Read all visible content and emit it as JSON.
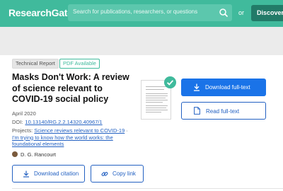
{
  "header": {
    "logo": "ResearchGate",
    "search_placeholder": "Search for publications, researchers, or questions",
    "or_label": "or",
    "discover_label": "Discover by"
  },
  "publication": {
    "type_badge": "Technical Report",
    "pdf_badge": "PDF Available",
    "title": "Masks Don't Work: A review of science relevant to COVID-19 social policy",
    "date": "April 2020",
    "doi_label": "DOI:",
    "doi_value": "10.13140/RG.2.2.14320.40967/1",
    "projects_label": "Projects:",
    "project_1": "Science reviews relevant to COVID-19",
    "project_separator": " · ",
    "project_2": "I'm trying to know how the world works: the foundational elements",
    "author": "D. G. Rancourt"
  },
  "actions": {
    "download_citation": "Download citation",
    "copy_link": "Copy link",
    "download_fulltext": "Download full-text",
    "read_fulltext": "Read full-text"
  },
  "colors": {
    "brand": "#40ba9c",
    "link": "#2361c2",
    "primary_button": "#1a73e8"
  },
  "icons": [
    "search-icon",
    "download-icon",
    "link-icon",
    "document-icon",
    "check-icon"
  ]
}
